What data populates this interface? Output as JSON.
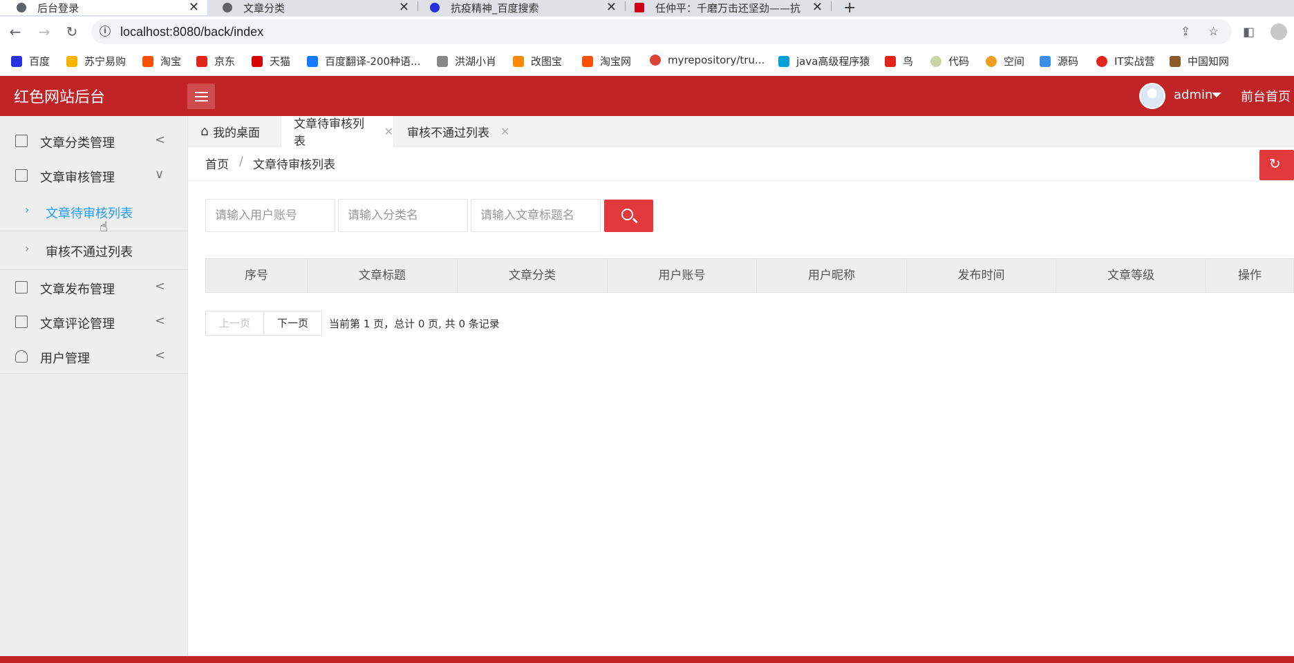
{
  "browser": {
    "tabs": [
      {
        "title": "后台登录",
        "active": true
      },
      {
        "title": "文章分类",
        "active": false
      },
      {
        "title": "抗疫精神_百度搜索",
        "active": false
      },
      {
        "title": "任仲平：千磨万击还坚劲——抗",
        "active": false
      }
    ],
    "new_tab": "+",
    "url": "localhost:8080/back/index",
    "bookmarks": [
      {
        "label": "百度",
        "color": "#2932e1"
      },
      {
        "label": "苏宁易购",
        "color": "#f7b500"
      },
      {
        "label": "淘宝",
        "color": "#ff5000"
      },
      {
        "label": "京东",
        "color": "#e1251b"
      },
      {
        "label": "天猫",
        "color": "#d60000"
      },
      {
        "label": "百度翻译-200种语...",
        "color": "#1677ff"
      },
      {
        "label": "洪湖小肖",
        "color": "#666666"
      },
      {
        "label": "改图宝",
        "color": "#ff8a00"
      },
      {
        "label": "淘宝网",
        "color": "#ff5000"
      },
      {
        "label": "myrepository/tru...",
        "color": "#dc4437"
      },
      {
        "label": "java高级程序猿",
        "color": "#00a1d6"
      },
      {
        "label": "鸟",
        "color": "#e1251b"
      },
      {
        "label": "代码",
        "color": "#c9d6a3"
      },
      {
        "label": "空间",
        "color": "#f0a020"
      },
      {
        "label": "源码",
        "color": "#3a8ee6"
      },
      {
        "label": "IT实战营",
        "color": "#e1251b"
      },
      {
        "label": "中国知网",
        "color": "#8b5a2b"
      }
    ]
  },
  "header": {
    "brand": "红色网站后台",
    "user": "admin",
    "front_link": "前台首页",
    "bg_color": "#c02427"
  },
  "sidebar": {
    "items": [
      {
        "label": "文章分类管理",
        "arrow": "<"
      },
      {
        "label": "文章审核管理",
        "arrow": "∨"
      },
      {
        "label": "文章发布管理",
        "arrow": "<"
      },
      {
        "label": "文章评论管理",
        "arrow": "<"
      },
      {
        "label": "用户管理",
        "arrow": "<"
      }
    ],
    "sub_items": [
      {
        "label": "文章待审核列表",
        "active": true
      },
      {
        "label": "审核不通过列表",
        "active": false
      }
    ],
    "active_color": "#1e9fff"
  },
  "page_tabs": [
    {
      "label": "我的桌面",
      "icon": "home-icon"
    },
    {
      "label": "文章待审核列表",
      "closable": true,
      "active": true
    },
    {
      "label": "审核不通过列表",
      "closable": true
    }
  ],
  "breadcrumb": {
    "home": "首页",
    "sep": "/",
    "current": "文章待审核列表"
  },
  "search": {
    "account_placeholder": "请输入用户账号",
    "category_placeholder": "请输入分类名",
    "title_placeholder": "请输入文章标题名",
    "button_color": "#e2393c"
  },
  "table": {
    "columns": [
      "序号",
      "文章标题",
      "文章分类",
      "用户账号",
      "用户昵称",
      "发布时间",
      "文章等级",
      "操作"
    ],
    "rows": []
  },
  "pagination": {
    "prev": "上一页",
    "next": "下一页",
    "info": "当前第 1 页，总计 0 页, 共 0 条记录"
  }
}
